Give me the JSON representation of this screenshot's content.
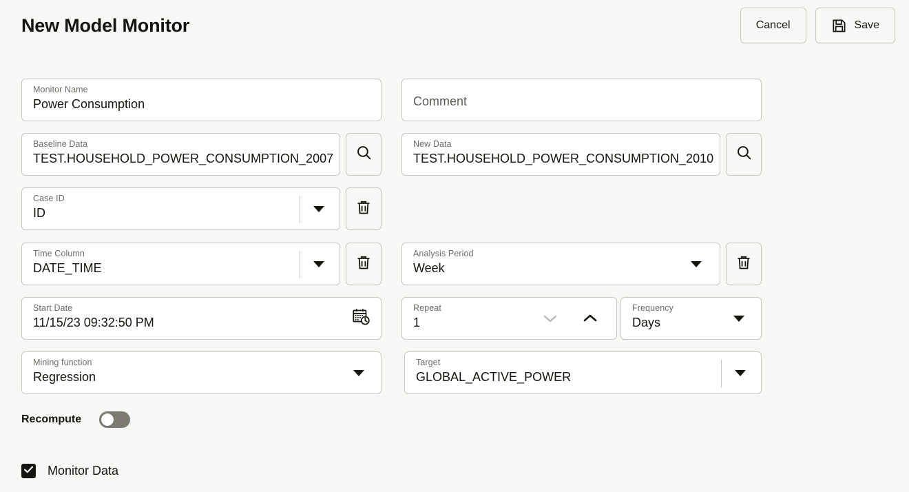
{
  "header": {
    "title": "New Model Monitor",
    "cancel_label": "Cancel",
    "save_label": "Save"
  },
  "form": {
    "monitor_name": {
      "label": "Monitor Name",
      "value": "Power Consumption"
    },
    "comment": {
      "placeholder": "Comment",
      "value": ""
    },
    "baseline_data": {
      "label": "Baseline Data",
      "value": "TEST.HOUSEHOLD_POWER_CONSUMPTION_2007"
    },
    "new_data": {
      "label": "New Data",
      "value": "TEST.HOUSEHOLD_POWER_CONSUMPTION_2010"
    },
    "case_id": {
      "label": "Case ID",
      "value": "ID"
    },
    "time_column": {
      "label": "Time Column",
      "value": "DATE_TIME"
    },
    "analysis_period": {
      "label": "Analysis Period",
      "value": "Week"
    },
    "start_date": {
      "label": "Start Date",
      "value": "11/15/23 09:32:50 PM"
    },
    "repeat": {
      "label": "Repeat",
      "value": "1"
    },
    "frequency": {
      "label": "Frequency",
      "value": "Days"
    },
    "mining_function": {
      "label": "Mining function",
      "value": "Regression"
    },
    "target": {
      "label": "Target",
      "value": "GLOBAL_ACTIVE_POWER"
    },
    "recompute": {
      "label": "Recompute",
      "state": "off"
    },
    "monitor_data": {
      "label": "Monitor Data",
      "state": "checked"
    }
  },
  "colors": {
    "page_background": "#f7f7f5",
    "field_background": "#ffffff",
    "border": "#c9c7c1",
    "text": "#16150f",
    "label_text": "#6d6a64",
    "toggle_off_track": "#7d7a73",
    "disabled_icon": "#b9b7b1"
  }
}
